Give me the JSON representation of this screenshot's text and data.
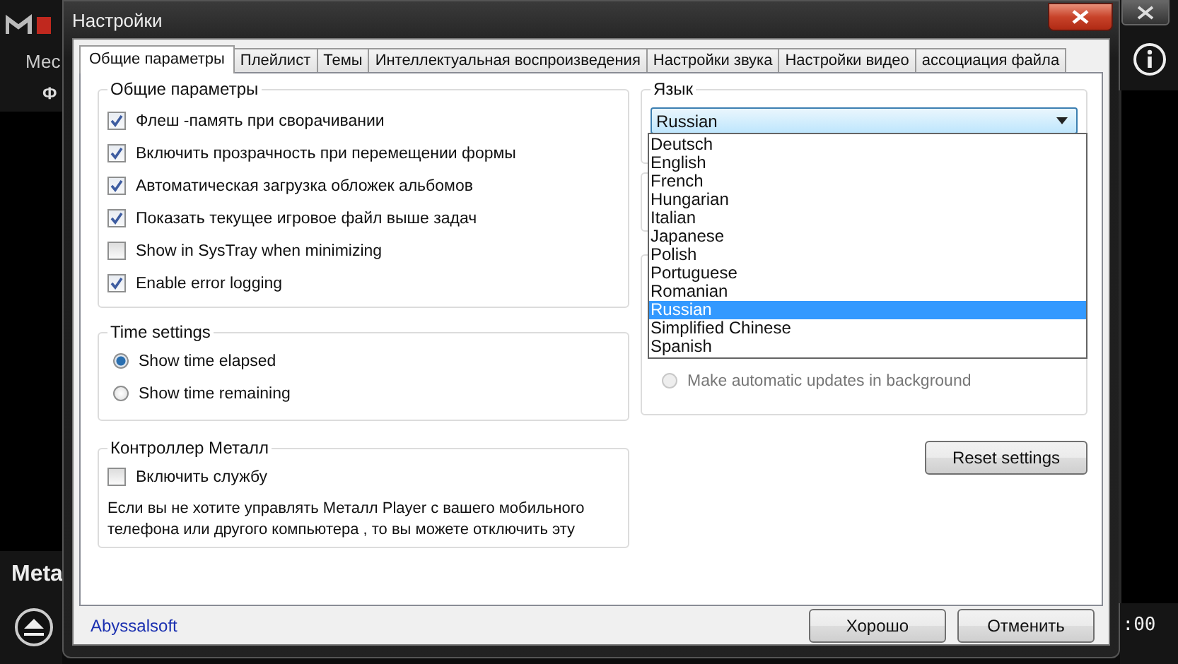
{
  "player": {
    "tab": "Мес",
    "label": "Ф",
    "title": "Meta",
    "time": ":00"
  },
  "dialog": {
    "title": "Настройки",
    "tabs": [
      {
        "label": "Общие параметры",
        "selected": true
      },
      {
        "label": "Плейлист",
        "selected": false
      },
      {
        "label": "Темы",
        "selected": false
      },
      {
        "label": "Интеллектуальная воспроизведения",
        "selected": false
      },
      {
        "label": "Настройки звука",
        "selected": false
      },
      {
        "label": "Настройки видео",
        "selected": false
      },
      {
        "label": "ассоциация файла",
        "selected": false
      }
    ],
    "general": {
      "title": "Общие параметры",
      "options": [
        {
          "label": "Флеш -память при сворачивании",
          "checked": true
        },
        {
          "label": "Включить прозрачность при перемещении формы",
          "checked": true
        },
        {
          "label": "Автоматическая загрузка обложек альбомов",
          "checked": true
        },
        {
          "label": "Показать текущее игровое файл выше задач",
          "checked": true
        },
        {
          "label": "Show in SysTray when minimizing",
          "checked": false
        },
        {
          "label": "Enable error logging",
          "checked": true
        }
      ]
    },
    "time": {
      "title": "Time settings",
      "options": [
        {
          "label": "Show time elapsed",
          "selected": true
        },
        {
          "label": "Show time remaining",
          "selected": false
        }
      ]
    },
    "controller": {
      "title": "Контроллер Металл",
      "option": {
        "label": "Включить службу",
        "checked": false
      },
      "note": "Если вы не хотите управлять Металл Player с вашего мобильного телефона или другого компьютера , то вы можете отключить эту"
    },
    "language": {
      "title": "Язык",
      "value": "Russian",
      "expanded": true,
      "options": [
        {
          "label": "Deutsch",
          "selected": false
        },
        {
          "label": "English",
          "selected": false
        },
        {
          "label": "French",
          "selected": false
        },
        {
          "label": "Hungarian",
          "selected": false
        },
        {
          "label": "Italian",
          "selected": false
        },
        {
          "label": "Japanese",
          "selected": false
        },
        {
          "label": "Polish",
          "selected": false
        },
        {
          "label": "Portuguese",
          "selected": false
        },
        {
          "label": "Romanian",
          "selected": false
        },
        {
          "label": "Russian",
          "selected": true
        },
        {
          "label": "Simplified Chinese",
          "selected": false
        },
        {
          "label": "Spanish",
          "selected": false
        }
      ]
    },
    "updates": {
      "label": "Make automatic updates in background",
      "selected": false,
      "disabled": true
    },
    "reset": "Reset settings",
    "link": "Abyssalsoft",
    "buttons": [
      "Хорошо",
      "Отменить"
    ]
  }
}
